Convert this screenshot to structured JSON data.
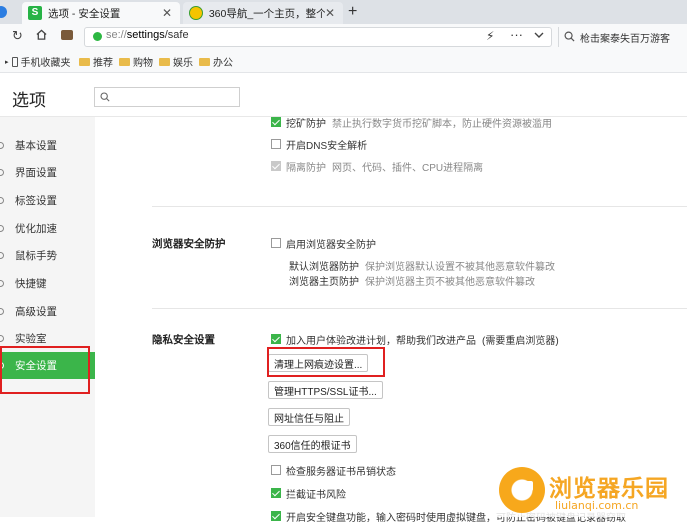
{
  "tabs": [
    {
      "title": "选项 - 安全设置",
      "active": true
    },
    {
      "title": "360导航_一个主页，整个世界",
      "active": false
    }
  ],
  "new_tab_symbol": "+",
  "address": {
    "scheme": "se://",
    "host": "settings",
    "path": "/safe"
  },
  "search_box": {
    "text": "枪击案泰失百万游客"
  },
  "bookmarks": [
    {
      "label": "手机收藏夹"
    },
    {
      "label": "推荐"
    },
    {
      "label": "购物"
    },
    {
      "label": "娱乐"
    },
    {
      "label": "办公"
    }
  ],
  "page": {
    "title": "选项"
  },
  "sidebar": {
    "items": [
      {
        "label": "基本设置"
      },
      {
        "label": "界面设置"
      },
      {
        "label": "标签设置"
      },
      {
        "label": "优化加速"
      },
      {
        "label": "鼠标手势"
      },
      {
        "label": "快捷键"
      },
      {
        "label": "高级设置"
      },
      {
        "label": "实验室"
      },
      {
        "label": "安全设置",
        "active": true
      }
    ]
  },
  "top_options": [
    {
      "label": "挖矿防护",
      "desc": "禁止执行数字货币挖矿脚本，防止硬件资源被滥用",
      "state": "checked"
    },
    {
      "label": "开启DNS安全解析",
      "desc": "",
      "state": "unchecked"
    },
    {
      "label": "隔离防护",
      "desc": "网页、代码、插件、CPU进程隔离",
      "state": "disabled"
    }
  ],
  "browser_protect": {
    "heading": "浏览器安全防护",
    "enable_label": "启用浏览器安全防护",
    "rows": [
      {
        "label": "默认浏览器防护",
        "desc": "保护浏览器默认设置不被其他恶意软件篡改"
      },
      {
        "label": "浏览器主页防护",
        "desc": "保护浏览器主页不被其他恶意软件篡改"
      }
    ]
  },
  "privacy": {
    "heading": "隐私安全设置",
    "experience": {
      "label": "加入用户体验改进计划，帮助我们改进产品",
      "note": "(需要重启浏览器)"
    },
    "buttons": [
      {
        "label": "清理上网痕迹设置..."
      },
      {
        "label": "管理HTTPS/SSL证书..."
      },
      {
        "label": "网址信任与阻止"
      },
      {
        "label": "360信任的根证书"
      }
    ],
    "checks": [
      {
        "label": "检查服务器证书吊销状态",
        "state": "unchecked"
      },
      {
        "label": "拦截证书风险",
        "state": "checked"
      },
      {
        "label": "开启安全键盘功能，输入密码时使用虚拟键盘，可防止密码被键盘记录器窃取",
        "state": "checked"
      }
    ]
  },
  "watermark": {
    "title": "浏览器乐园",
    "url": "liulanqi.com.cn"
  },
  "colors": {
    "accent": "#3bb54a",
    "highlight_box": "#e02020",
    "watermark": "#f5a623"
  }
}
